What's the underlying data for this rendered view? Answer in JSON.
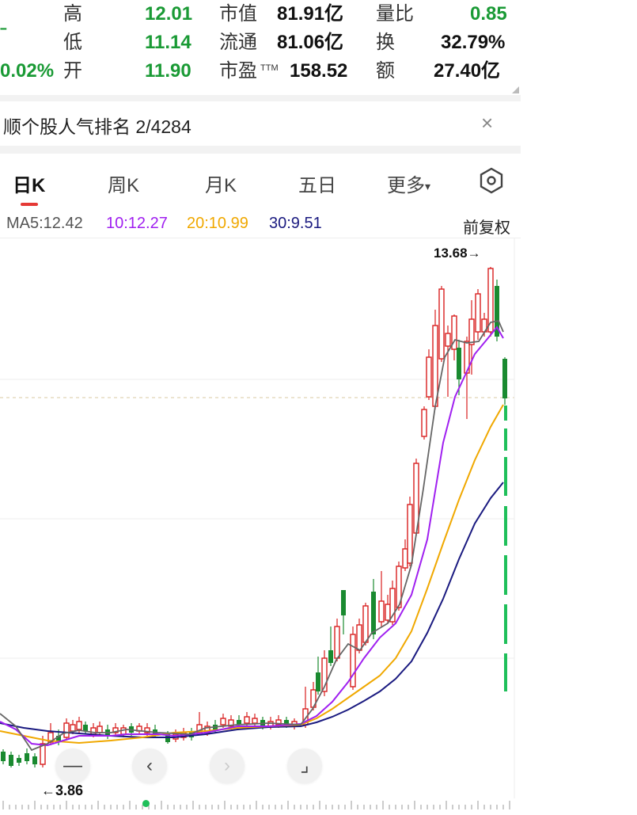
{
  "quote": {
    "change_pct": "0.02%",
    "high_label": "高",
    "high_value": "12.01",
    "low_label": "低",
    "low_value": "11.14",
    "open_label": "开",
    "open_value": "11.90",
    "mcap_label": "市值",
    "mcap_value": "81.91亿",
    "float_label": "流通",
    "float_value": "81.06亿",
    "pe_label": "市盈",
    "pe_sup": "TTM",
    "pe_value": "158.52",
    "vr_label": "量比",
    "vr_value": "0.85",
    "turnover_label": "换",
    "turnover_value": "32.79%",
    "amount_label": "额",
    "amount_value": "27.40亿"
  },
  "rank": {
    "text": "顺个股人气排名 2/4284",
    "close": "×"
  },
  "tabs": [
    {
      "label": "日K",
      "active": true
    },
    {
      "label": "周K"
    },
    {
      "label": "月K"
    },
    {
      "label": "五日"
    },
    {
      "label": "更多"
    }
  ],
  "tabs_more_caret": "▾",
  "settings_icon": "hexagon-gear-icon",
  "ma": {
    "ma5": "MA5:12.42",
    "ma10": "10:12.27",
    "ma20": "20:10.99",
    "ma30": "30:9.51",
    "adjust": "前复权",
    "colors": {
      "ma5": "#555555",
      "ma10": "#a020f0",
      "ma20": "#f0a800",
      "ma30": "#1a1a80"
    }
  },
  "chart_data": {
    "type": "candlestick",
    "max_label": "13.68→",
    "min_label": "←3.86",
    "colors": {
      "up": "#d81e1e",
      "down": "#1a8a30",
      "dashed_bar": "#1fbf5a"
    }
  },
  "controls": [
    {
      "name": "zoom-out",
      "label": "—"
    },
    {
      "name": "prev",
      "label": "‹"
    },
    {
      "name": "next",
      "label": "›"
    },
    {
      "name": "fullscreen",
      "label": "⌟"
    }
  ]
}
